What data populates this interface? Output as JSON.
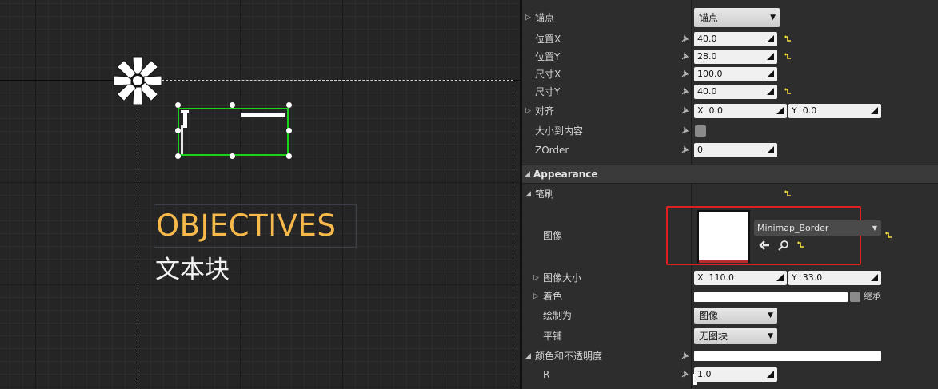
{
  "canvas": {
    "title_text": "OBJECTIVES",
    "text_block": "文本块",
    "colors": {
      "title": "#f7b94a",
      "selection": "#19d419",
      "text": "#f2f2f2"
    }
  },
  "details": {
    "anchor": {
      "label": "锚点",
      "value": "锚点"
    },
    "position_x": {
      "label": "位置X",
      "value": "40.0"
    },
    "position_y": {
      "label": "位置Y",
      "value": "28.0"
    },
    "size_x": {
      "label": "尺寸X",
      "value": "100.0"
    },
    "size_y": {
      "label": "尺寸Y",
      "value": "40.0"
    },
    "alignment": {
      "label": "对齐",
      "x_prefix": "X",
      "x": "0.0",
      "y_prefix": "Y",
      "y": "0.0"
    },
    "size_to_content": {
      "label": "大小到内容",
      "checked": false
    },
    "zorder": {
      "label": "ZOrder",
      "value": "0"
    },
    "appearance": {
      "label": "Appearance"
    },
    "brush": {
      "label": "笔刷"
    },
    "image": {
      "label": "图像",
      "asset": "Minimap_Border"
    },
    "image_size": {
      "label": "图像大小",
      "x_prefix": "X",
      "x": "110.0",
      "y_prefix": "Y",
      "y": "33.0"
    },
    "tint": {
      "label": "着色",
      "inherit_label": "继承"
    },
    "draw_as": {
      "label": "绘制为",
      "value": "图像"
    },
    "tiling": {
      "label": "平铺",
      "value": "无图块"
    },
    "color_opacity": {
      "label": "颜色和不透明度"
    },
    "r": {
      "label": "R",
      "value": "1.0"
    },
    "highlight_color": "#e02020"
  }
}
